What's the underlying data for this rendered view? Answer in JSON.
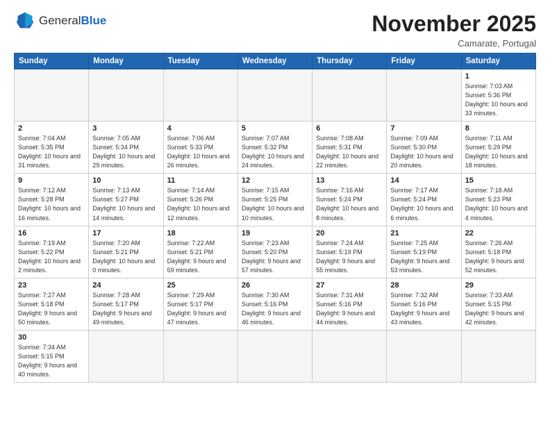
{
  "logo": {
    "text_normal": "General",
    "text_blue": "Blue"
  },
  "header": {
    "title": "November 2025",
    "subtitle": "Camarate, Portugal"
  },
  "weekdays": [
    "Sunday",
    "Monday",
    "Tuesday",
    "Wednesday",
    "Thursday",
    "Friday",
    "Saturday"
  ],
  "days": [
    {
      "num": "",
      "info": ""
    },
    {
      "num": "",
      "info": ""
    },
    {
      "num": "",
      "info": ""
    },
    {
      "num": "",
      "info": ""
    },
    {
      "num": "",
      "info": ""
    },
    {
      "num": "",
      "info": ""
    },
    {
      "num": "1",
      "info": "Sunrise: 7:03 AM\nSunset: 5:36 PM\nDaylight: 10 hours and 33 minutes."
    },
    {
      "num": "2",
      "info": "Sunrise: 7:04 AM\nSunset: 5:35 PM\nDaylight: 10 hours and 31 minutes."
    },
    {
      "num": "3",
      "info": "Sunrise: 7:05 AM\nSunset: 5:34 PM\nDaylight: 10 hours and 29 minutes."
    },
    {
      "num": "4",
      "info": "Sunrise: 7:06 AM\nSunset: 5:33 PM\nDaylight: 10 hours and 26 minutes."
    },
    {
      "num": "5",
      "info": "Sunrise: 7:07 AM\nSunset: 5:32 PM\nDaylight: 10 hours and 24 minutes."
    },
    {
      "num": "6",
      "info": "Sunrise: 7:08 AM\nSunset: 5:31 PM\nDaylight: 10 hours and 22 minutes."
    },
    {
      "num": "7",
      "info": "Sunrise: 7:09 AM\nSunset: 5:30 PM\nDaylight: 10 hours and 20 minutes."
    },
    {
      "num": "8",
      "info": "Sunrise: 7:11 AM\nSunset: 5:29 PM\nDaylight: 10 hours and 18 minutes."
    },
    {
      "num": "9",
      "info": "Sunrise: 7:12 AM\nSunset: 5:28 PM\nDaylight: 10 hours and 16 minutes."
    },
    {
      "num": "10",
      "info": "Sunrise: 7:13 AM\nSunset: 5:27 PM\nDaylight: 10 hours and 14 minutes."
    },
    {
      "num": "11",
      "info": "Sunrise: 7:14 AM\nSunset: 5:26 PM\nDaylight: 10 hours and 12 minutes."
    },
    {
      "num": "12",
      "info": "Sunrise: 7:15 AM\nSunset: 5:25 PM\nDaylight: 10 hours and 10 minutes."
    },
    {
      "num": "13",
      "info": "Sunrise: 7:16 AM\nSunset: 5:24 PM\nDaylight: 10 hours and 8 minutes."
    },
    {
      "num": "14",
      "info": "Sunrise: 7:17 AM\nSunset: 5:24 PM\nDaylight: 10 hours and 6 minutes."
    },
    {
      "num": "15",
      "info": "Sunrise: 7:18 AM\nSunset: 5:23 PM\nDaylight: 10 hours and 4 minutes."
    },
    {
      "num": "16",
      "info": "Sunrise: 7:19 AM\nSunset: 5:22 PM\nDaylight: 10 hours and 2 minutes."
    },
    {
      "num": "17",
      "info": "Sunrise: 7:20 AM\nSunset: 5:21 PM\nDaylight: 10 hours and 0 minutes."
    },
    {
      "num": "18",
      "info": "Sunrise: 7:22 AM\nSunset: 5:21 PM\nDaylight: 9 hours and 59 minutes."
    },
    {
      "num": "19",
      "info": "Sunrise: 7:23 AM\nSunset: 5:20 PM\nDaylight: 9 hours and 57 minutes."
    },
    {
      "num": "20",
      "info": "Sunrise: 7:24 AM\nSunset: 5:19 PM\nDaylight: 9 hours and 55 minutes."
    },
    {
      "num": "21",
      "info": "Sunrise: 7:25 AM\nSunset: 5:19 PM\nDaylight: 9 hours and 53 minutes."
    },
    {
      "num": "22",
      "info": "Sunrise: 7:26 AM\nSunset: 5:18 PM\nDaylight: 9 hours and 52 minutes."
    },
    {
      "num": "23",
      "info": "Sunrise: 7:27 AM\nSunset: 5:18 PM\nDaylight: 9 hours and 50 minutes."
    },
    {
      "num": "24",
      "info": "Sunrise: 7:28 AM\nSunset: 5:17 PM\nDaylight: 9 hours and 49 minutes."
    },
    {
      "num": "25",
      "info": "Sunrise: 7:29 AM\nSunset: 5:17 PM\nDaylight: 9 hours and 47 minutes."
    },
    {
      "num": "26",
      "info": "Sunrise: 7:30 AM\nSunset: 5:16 PM\nDaylight: 9 hours and 46 minutes."
    },
    {
      "num": "27",
      "info": "Sunrise: 7:31 AM\nSunset: 5:16 PM\nDaylight: 9 hours and 44 minutes."
    },
    {
      "num": "28",
      "info": "Sunrise: 7:32 AM\nSunset: 5:16 PM\nDaylight: 9 hours and 43 minutes."
    },
    {
      "num": "29",
      "info": "Sunrise: 7:33 AM\nSunset: 5:15 PM\nDaylight: 9 hours and 42 minutes."
    },
    {
      "num": "30",
      "info": "Sunrise: 7:34 AM\nSunset: 5:15 PM\nDaylight: 9 hours and 40 minutes."
    },
    {
      "num": "",
      "info": ""
    },
    {
      "num": "",
      "info": ""
    },
    {
      "num": "",
      "info": ""
    },
    {
      "num": "",
      "info": ""
    },
    {
      "num": "",
      "info": ""
    },
    {
      "num": "",
      "info": ""
    },
    {
      "num": "",
      "info": ""
    }
  ]
}
